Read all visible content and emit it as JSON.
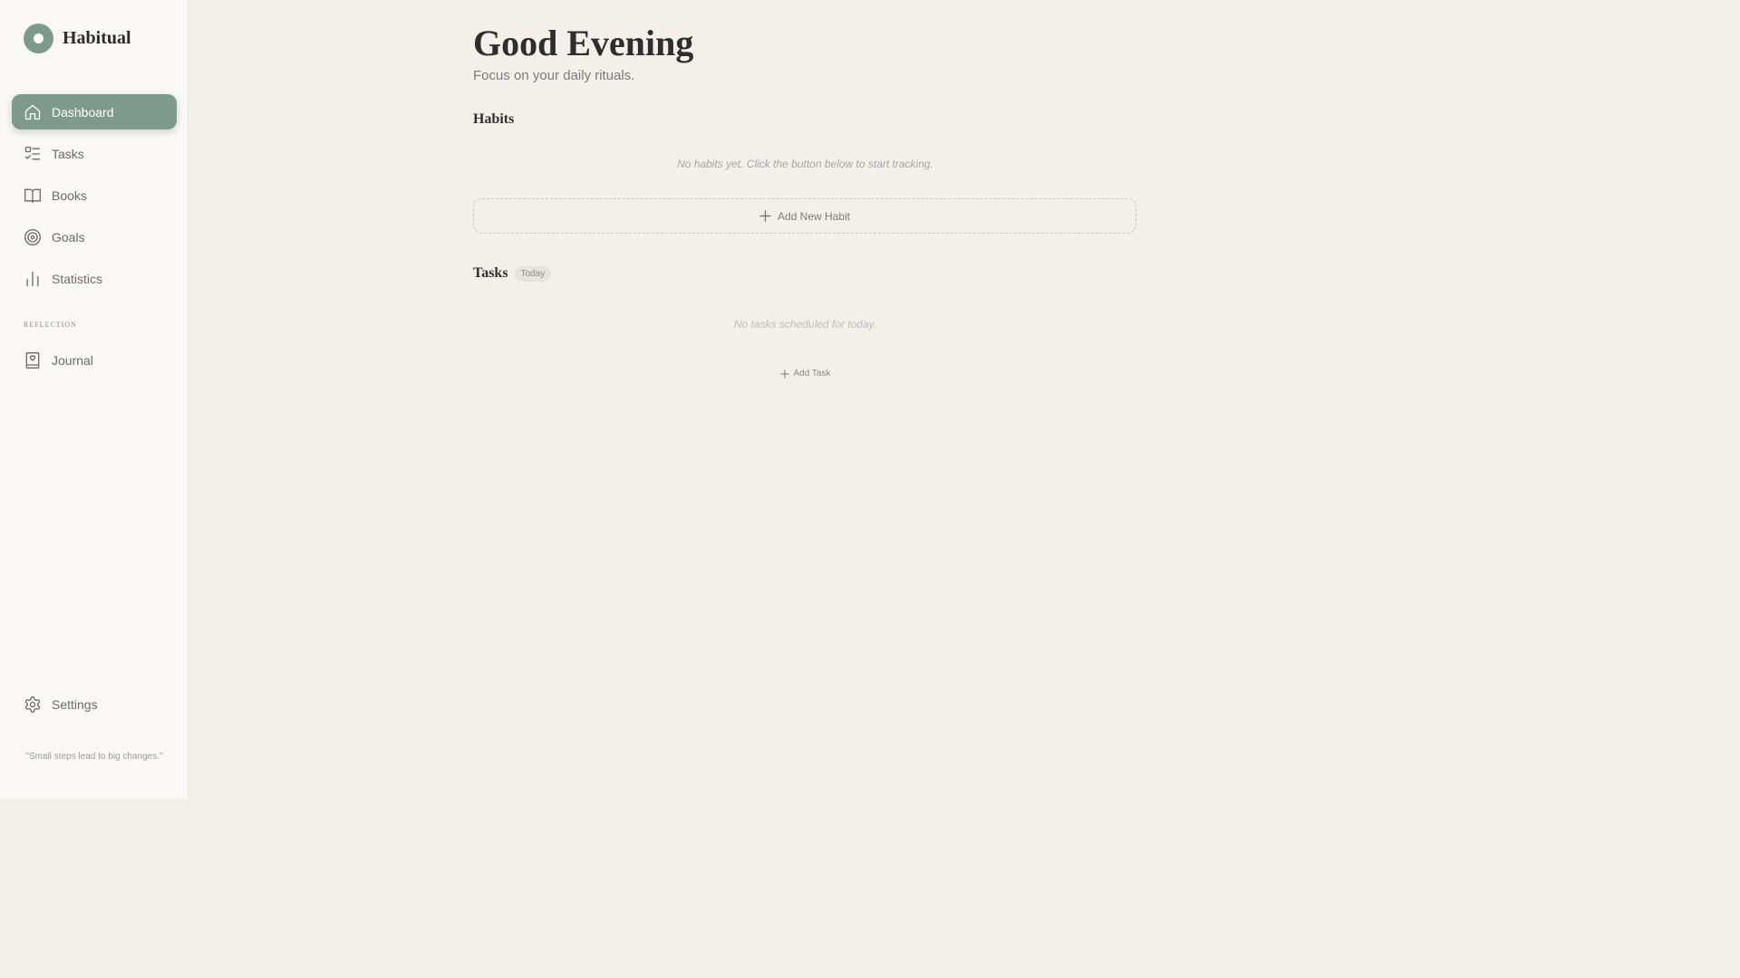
{
  "app": {
    "name": "Habitual",
    "accent": "#7e9a8f"
  },
  "sidebar": {
    "items": [
      {
        "label": "Dashboard",
        "icon": "home-icon",
        "active": true
      },
      {
        "label": "Tasks",
        "icon": "checklist-icon"
      },
      {
        "label": "Books",
        "icon": "book-open-icon"
      },
      {
        "label": "Goals",
        "icon": "target-icon"
      },
      {
        "label": "Statistics",
        "icon": "bar-chart-icon"
      }
    ],
    "section_label": "REFLECTION",
    "reflection_items": [
      {
        "label": "Journal",
        "icon": "journal-icon"
      }
    ],
    "settings_label": "Settings",
    "quote": "\"Small steps lead to big changes.\""
  },
  "main": {
    "greeting": "Good Evening",
    "subtitle": "Focus on your daily rituals.",
    "habits": {
      "title": "Habits",
      "empty_text": "No habits yet. Click the button below to start tracking.",
      "add_label": "Add New Habit"
    },
    "tasks": {
      "title": "Tasks",
      "badge": "Today",
      "empty_text": "No tasks scheduled for today.",
      "add_label": "Add Task"
    }
  }
}
